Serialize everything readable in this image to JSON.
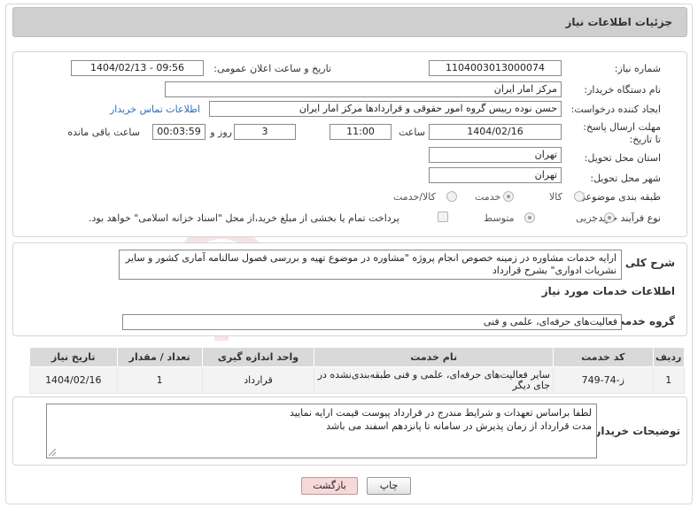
{
  "title": "جزئیات اطلاعات نیاز",
  "fields": {
    "need_number_label": "شماره نیاز:",
    "need_number": "1104003013000074",
    "announce_label": "تاریخ و ساعت اعلان عمومی:",
    "announce_value": "1404/02/13 - 09:56",
    "buyer_org_label": "نام دستگاه خریدار:",
    "buyer_org": "مرکز امار ایران",
    "creator_label": "ایجاد کننده درخواست:",
    "creator": "حسن نوده رییس گروه امور حقوقی و قراردادها مرکز امار ایران",
    "contact_link": "اطلاعات تماس خریدار",
    "deadline_label": "مهلت ارسال پاسخ: تا تاریخ:",
    "deadline_date": "1404/02/16",
    "time_label": "ساعت",
    "deadline_time": "11:00",
    "days_value": "3",
    "days_label": "روز و",
    "remaining_time": "00:03:59",
    "remaining_label": "ساعت باقی مانده",
    "province_label": "استان محل تحویل:",
    "province": "تهران",
    "city_label": "شهر محل تحویل:",
    "city": "تهران",
    "category_label": "طبقه بندی موضوعی:",
    "category_options": [
      "کالا",
      "خدمت",
      "کالا/خدمت"
    ],
    "category_selected": "خدمت",
    "process_label": "نوع فرآیند خرید :",
    "process_options": [
      "جزیی",
      "متوسط"
    ],
    "process_selected": "جزیی",
    "payment_note": "پرداخت تمام یا بخشی از مبلغ خرید،از محل \"اسناد خزانه اسلامی\" خواهد بود."
  },
  "description": {
    "label": "شرح کلی نیاز:",
    "text": "ارایه خدمات مشاوره در  زمینه خصوص انجام پروژه \"مشاوره در موضوع تهیه و بررسی فصول سالنامه آماری کشور و سایر نشریات ادواری\" بشرح قرارداد"
  },
  "services": {
    "section_title": "اطلاعات خدمات مورد نیاز",
    "group_label": "گروه خدمت:",
    "group_value": "فعالیت‌های حرفه‌ای، علمی و فنی",
    "columns": [
      "ردیف",
      "کد خدمت",
      "نام خدمت",
      "واحد اندازه گیری",
      "تعداد / مقدار",
      "تاریخ نیاز"
    ],
    "rows": [
      [
        "1",
        "ز-74-749",
        "سایر فعالیت‌های حرفه‌ای، علمی و فنی طبقه‌بندی‌نشده در جای دیگر",
        "قرارداد",
        "1",
        "1404/02/16"
      ]
    ]
  },
  "buyer_notes": {
    "label": "توضیحات خریدار:",
    "line1": "لطفا براساس  تعهدات و شرایط مندرج در قرارداد پیوست قیمت ارایه نمایید",
    "line2": "مدت قرارداد از زمان پذیرش در سامانه تا پانزدهم اسفند می باشد"
  },
  "buttons": {
    "print": "چاپ",
    "back": "بازگشت"
  },
  "watermark_text": "AriaTender.neT",
  "colors": {
    "title_bg": "#cfcfcf",
    "link": "#2e6fb8",
    "back_button": "#f8d8d8",
    "table_header": "#d9d9d9"
  }
}
